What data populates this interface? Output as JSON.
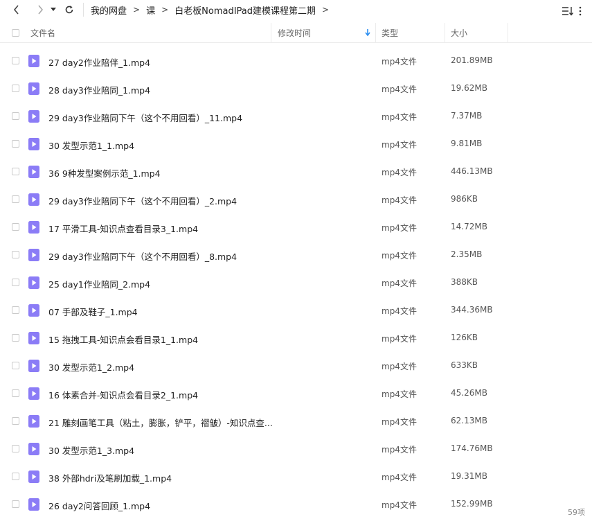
{
  "breadcrumb": [
    "我的网盘",
    "课",
    "白老板NomadIPad建模课程第二期"
  ],
  "breadcrumb_sep": ">",
  "columns": {
    "name": "文件名",
    "modified": "修改时间",
    "type": "类型",
    "size": "大小"
  },
  "files": [
    {
      "name": "27  day2作业陪伴_1.mp4",
      "type": "mp4文件",
      "size": "201.89MB"
    },
    {
      "name": "28  day3作业陪同_1.mp4",
      "type": "mp4文件",
      "size": "19.62MB"
    },
    {
      "name": "29  day3作业陪同下午（这个不用回看）_11.mp4",
      "type": "mp4文件",
      "size": "7.37MB"
    },
    {
      "name": "30  发型示范1_1.mp4",
      "type": "mp4文件",
      "size": "9.81MB"
    },
    {
      "name": "36  9种发型案例示范_1.mp4",
      "type": "mp4文件",
      "size": "446.13MB"
    },
    {
      "name": "29  day3作业陪同下午（这个不用回看）_2.mp4",
      "type": "mp4文件",
      "size": "986KB"
    },
    {
      "name": "17  平滑工具-知识点查看目录3_1.mp4",
      "type": "mp4文件",
      "size": "14.72MB"
    },
    {
      "name": "29  day3作业陪同下午（这个不用回看）_8.mp4",
      "type": "mp4文件",
      "size": "2.35MB"
    },
    {
      "name": "25  day1作业陪同_2.mp4",
      "type": "mp4文件",
      "size": "388KB"
    },
    {
      "name": "07  手部及鞋子_1.mp4",
      "type": "mp4文件",
      "size": "344.36MB"
    },
    {
      "name": "15  拖拽工具-知识点会看目录1_1.mp4",
      "type": "mp4文件",
      "size": "126KB"
    },
    {
      "name": "30  发型示范1_2.mp4",
      "type": "mp4文件",
      "size": "633KB"
    },
    {
      "name": "16  体素合并-知识点会看目录2_1.mp4",
      "type": "mp4文件",
      "size": "45.26MB"
    },
    {
      "name": "21  雕刻画笔工具（粘土，膨胀，铲平，褶皱）-知识点查...",
      "type": "mp4文件",
      "size": "62.13MB"
    },
    {
      "name": "30  发型示范1_3.mp4",
      "type": "mp4文件",
      "size": "174.76MB"
    },
    {
      "name": "38  外部hdri及笔刷加载_1.mp4",
      "type": "mp4文件",
      "size": "19.31MB"
    },
    {
      "name": "26  day2问答回顾_1.mp4",
      "type": "mp4文件",
      "size": "152.99MB"
    }
  ],
  "item_count": "59项",
  "colors": {
    "icon": "#8b7cf6",
    "accent": "#2e8ff0"
  },
  "icons": {
    "back": "chevron-left-icon",
    "forward": "chevron-right-icon",
    "dropdown": "caret-down-icon",
    "refresh": "refresh-icon",
    "sort": "sort-icon",
    "file": "video-file-icon",
    "sort_arrow": "arrow-down-icon"
  }
}
